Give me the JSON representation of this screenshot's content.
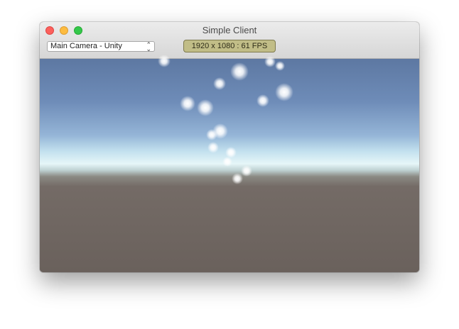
{
  "window": {
    "title": "Simple Client"
  },
  "toolbar": {
    "camera_select": {
      "selected": "Main Camera - Unity"
    },
    "stats_badge": "1920 x 1080 : 61 FPS"
  },
  "colors": {
    "close": "#fc605c",
    "minimize": "#fdbc40",
    "zoom": "#34c84a",
    "badge": "#c1bd87",
    "sky_top": "#5d78a2",
    "horizon": "#e6f6f8",
    "ground": "#6a615c"
  },
  "icons": {
    "select_arrows": "chevron-up-down-icon"
  }
}
